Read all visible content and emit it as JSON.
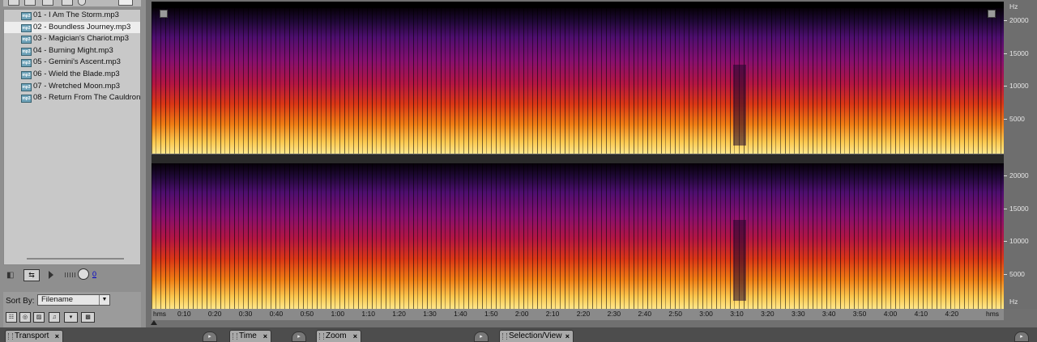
{
  "file_panel": {
    "files": [
      {
        "name": "01 - I Am The Storm.mp3",
        "selected": false
      },
      {
        "name": "02 - Boundless Journey.mp3",
        "selected": true
      },
      {
        "name": "03 - Magician's Chariot.mp3",
        "selected": false
      },
      {
        "name": "04 - Burning Might.mp3",
        "selected": false
      },
      {
        "name": "05 - Gemini's Ascent.mp3",
        "selected": false
      },
      {
        "name": "06 - Wield the Blade.mp3",
        "selected": false
      },
      {
        "name": "07 - Wretched Moon.mp3",
        "selected": false
      },
      {
        "name": "08 - Return From The Cauldron.mp3",
        "selected": false
      }
    ],
    "volume_value": "0",
    "sort_by_label": "Sort By:",
    "sort_by_value": "Filename"
  },
  "spectral_view": {
    "freq_unit": "Hz",
    "freq_ticks": [
      20000,
      15000,
      10000,
      5000
    ],
    "freq_max": 22050,
    "time_unit_left": "hms",
    "time_unit_right": "hms",
    "time_ticks": [
      "0:10",
      "0:20",
      "0:30",
      "0:40",
      "0:50",
      "1:00",
      "1:10",
      "1:20",
      "1:30",
      "1:40",
      "1:50",
      "2:00",
      "2:10",
      "2:20",
      "2:30",
      "2:40",
      "2:50",
      "3:00",
      "3:10",
      "3:20",
      "3:30",
      "3:40",
      "3:50",
      "4:00",
      "4:10",
      "4:20"
    ],
    "duration_seconds": 276
  },
  "tabs": [
    {
      "label": "Transport"
    },
    {
      "label": "Time"
    },
    {
      "label": "Zoom"
    },
    {
      "label": "Selection/View"
    }
  ],
  "colors": {
    "spectrogram_low": "#ffe78c",
    "spectrogram_mid": "#da3615",
    "spectrogram_high": "#4d0e6e",
    "selected_row": "#ededed"
  }
}
